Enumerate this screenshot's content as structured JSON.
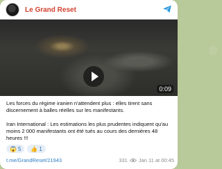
{
  "channel": {
    "name": "Le Grand Reset",
    "brand_color": "#d2402f"
  },
  "video": {
    "duration": "0:09"
  },
  "message": {
    "paragraph1": "Les forces du régime iranien n'attendent plus : elles tirent sans discernement à balles réelles sur les manifestants.",
    "paragraph2": "Iran International : Les estimations les plus prudentes indiquent qu'au moins 2 000 manifestants ont été tués au cours des dernières 48 heures !!!"
  },
  "reactions": [
    {
      "emoji": "😱",
      "count": "5"
    },
    {
      "emoji": "👍",
      "count": "1"
    }
  ],
  "footer": {
    "link": "t.me/GrandReset/21943",
    "views": "331",
    "date": "Jan 11 at 00:45"
  }
}
